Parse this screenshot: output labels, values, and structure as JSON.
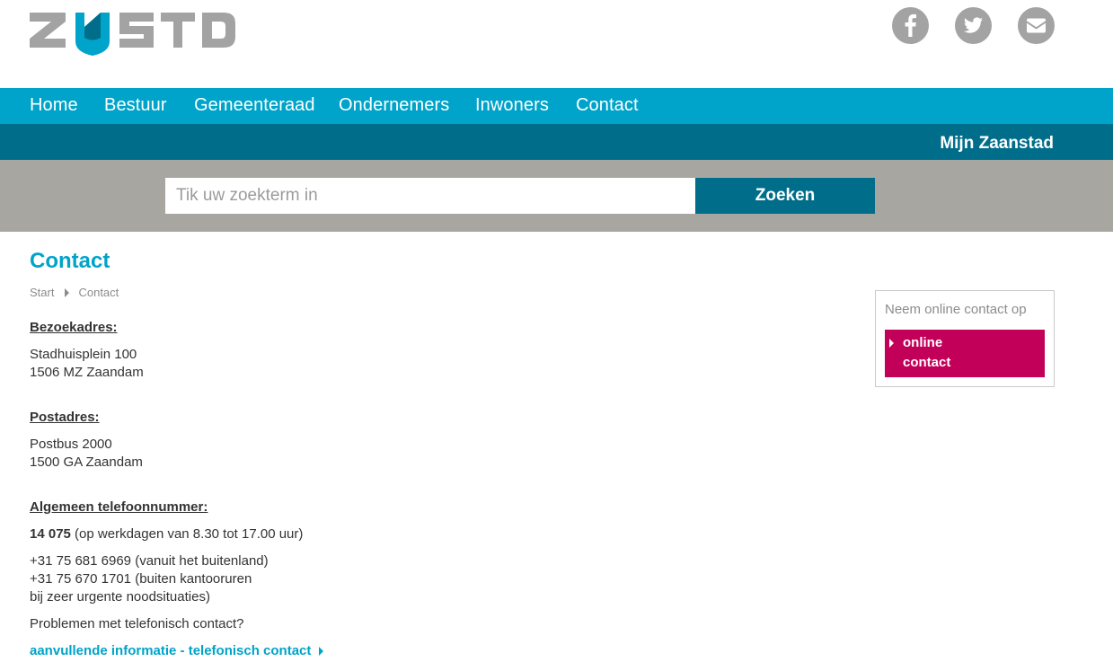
{
  "logo": {
    "text": "ZNSTD"
  },
  "social": [
    "facebook-icon",
    "twitter-icon",
    "envelope-icon"
  ],
  "nav": {
    "items": [
      "Home",
      "Bestuur",
      "Gemeenteraad",
      "Ondernemers",
      "Inwoners",
      "Contact"
    ]
  },
  "subbar": {
    "mijn": "Mijn Zaanstad"
  },
  "search": {
    "placeholder": "Tik uw zoekterm in",
    "button": "Zoeken"
  },
  "page": {
    "title": "Contact"
  },
  "breadcrumb": [
    "Start",
    "Contact"
  ],
  "visit": {
    "heading": "Bezoekadres:",
    "line1": "Stadhuisplein 100",
    "line2": "1506 MZ Zaandam"
  },
  "postal": {
    "heading": "Postadres:",
    "line1": "Postbus 2000",
    "line2": "1500 GA Zaandam"
  },
  "phone": {
    "heading": "Algemeen telefoonnummer:",
    "main_number": "14 075",
    "main_note": " (op werkdagen van 8.30 tot 17.00 uur)",
    "foreign": "+31 75 681 6969 (vanuit het buitenland)",
    "after_hours": "+31 75 670 1701 (buiten kantooruren",
    "urgent": "bij zeer urgente noodsituaties)",
    "problems": "Problemen met telefonisch contact?",
    "more_link": "aanvullende informatie - telefonisch contact"
  },
  "sidebox": {
    "title": "Neem online contact op",
    "button_line1": "online",
    "button_line2": "contact"
  },
  "colors": {
    "nav": "#00a3c9",
    "subbar": "#006e8a",
    "search_bg": "#a8a6a1",
    "accent": "#c2005a",
    "logo_grey": "#a3a3a3",
    "logo_blue": "#00a3c9"
  }
}
